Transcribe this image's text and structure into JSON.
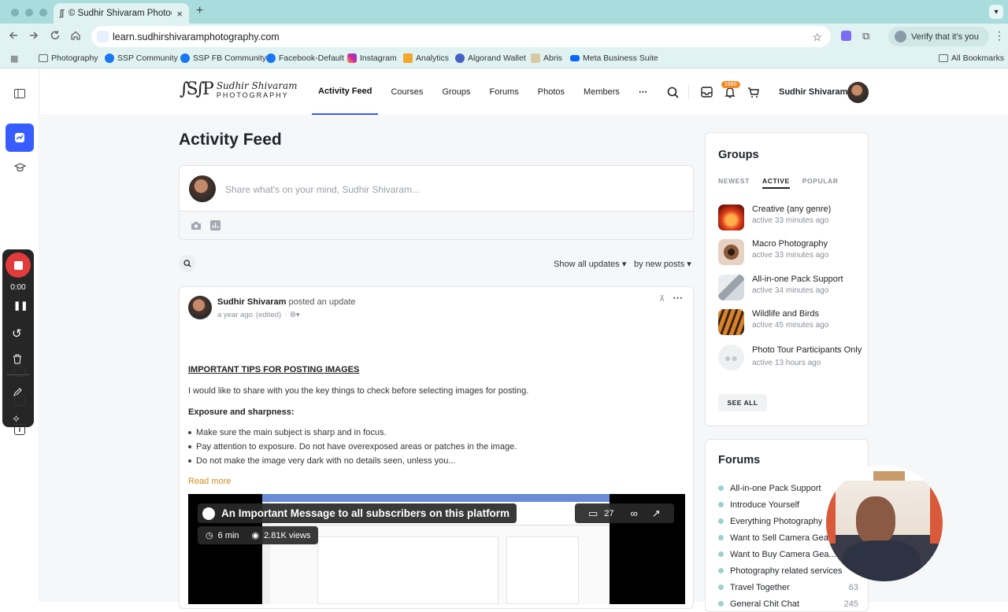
{
  "browser": {
    "tab_title": "© Sudhir Shivaram Photograp",
    "url": "learn.sudhirshivaramphotography.com",
    "verify_label": "Verify that it's you",
    "bookmarks": [
      "Photography",
      "SSP Community",
      "SSP FB Community",
      "Facebook-Default",
      "Instagram",
      "Analytics",
      "Algorand Wallet",
      "Abris",
      "Meta Business Suite"
    ],
    "all_bookmarks": "All Bookmarks"
  },
  "recorder": {
    "timer": "0:00"
  },
  "site": {
    "logo_top": "Sudhir Shivaram",
    "logo_bottom": "PHOTOGRAPHY",
    "nav": [
      "Activity Feed",
      "Courses",
      "Groups",
      "Forums",
      "Photos",
      "Members"
    ],
    "more": "⋯",
    "notif_count": "1680",
    "user_name": "Sudhir Shivaram"
  },
  "feed": {
    "title": "Activity Feed",
    "composer_placeholder": "Share what's on your mind, Sudhir Shivaram...",
    "filter_show": "Show all updates",
    "filter_sort": "by new posts",
    "post": {
      "author": "Sudhir Shivaram",
      "action": "posted an update",
      "time": "a year ago",
      "edited": "(edited)",
      "heading": "IMPORTANT TIPS FOR POSTING IMAGES",
      "intro": "I would like to share with you the key things to check before selecting images for posting.",
      "subheading": "Exposure and sharpness:",
      "bullets": [
        "Make sure the main subject is sharp and in focus.",
        "Pay attention to exposure. Do not have overexposed areas or patches in the image.",
        "Do not make the image very dark with no details seen, unless you..."
      ],
      "read_more": "Read more",
      "video": {
        "title": "An Important Message to all subscribers on this platform",
        "comments": "27",
        "duration": "6 min",
        "views": "2.81K views"
      }
    }
  },
  "groups": {
    "title": "Groups",
    "tabs": [
      "NEWEST",
      "ACTIVE",
      "POPULAR"
    ],
    "items": [
      {
        "name": "Creative (any genre)",
        "active": "active 33 minutes ago"
      },
      {
        "name": "Macro Photography",
        "active": "active 33 minutes ago"
      },
      {
        "name": "All-in-one Pack Support",
        "active": "active 34 minutes ago"
      },
      {
        "name": "Wildlife and Birds",
        "active": "active 45 minutes ago"
      },
      {
        "name": "Photo Tour Participants Only",
        "active": "active 13 hours ago"
      }
    ],
    "see_all": "SEE ALL"
  },
  "forums": {
    "title": "Forums",
    "items": [
      {
        "name": "All-in-one Pack Support",
        "count": ""
      },
      {
        "name": "Introduce Yourself",
        "count": ""
      },
      {
        "name": "Everything Photography",
        "count": ""
      },
      {
        "name": "Want to Sell Camera Gear...",
        "count": ""
      },
      {
        "name": "Want to Buy Camera Gea...",
        "count": ""
      },
      {
        "name": "Photography related services",
        "count": ""
      },
      {
        "name": "Travel Together",
        "count": "63"
      },
      {
        "name": "General Chit Chat",
        "count": "245"
      }
    ]
  }
}
